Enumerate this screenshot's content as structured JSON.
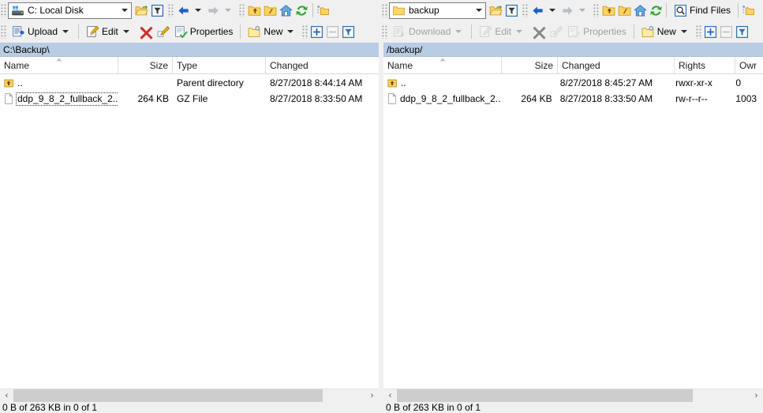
{
  "left": {
    "address": {
      "value": "C: Local Disk",
      "icon": "local-disk-icon"
    },
    "toolbar_nav": {
      "open_dir_icon": "open-folder-icon",
      "filter_icon": "filter-icon",
      "back_icon": "back-arrow-icon",
      "forward_icon": "forward-arrow-icon",
      "parent_icon": "parent-directory-icon",
      "root_icon": "root-directory-icon",
      "home_icon": "home-icon",
      "refresh_icon": "refresh-icon",
      "bookmark_icon": "add-bookmark-icon"
    },
    "toolbar_actions": [
      {
        "label": "Upload",
        "icon": "upload-icon",
        "dropdown": true,
        "disabled": false
      },
      {
        "label": "Edit",
        "icon": "edit-icon",
        "dropdown": true,
        "disabled": false
      },
      {
        "label": "",
        "icon": "delete-icon",
        "dropdown": false,
        "disabled": false
      },
      {
        "label": "",
        "icon": "rename-icon",
        "dropdown": false,
        "disabled": false
      },
      {
        "label": "Properties",
        "icon": "properties-icon",
        "dropdown": false,
        "disabled": false
      },
      {
        "label": "New",
        "icon": "new-folder-icon",
        "dropdown": true,
        "disabled": false
      },
      {
        "label": "",
        "icon": "select-plus-icon",
        "dropdown": false,
        "disabled": false
      },
      {
        "label": "",
        "icon": "select-minus-icon",
        "dropdown": false,
        "disabled": true
      },
      {
        "label": "",
        "icon": "selection-filter-icon",
        "dropdown": false,
        "disabled": false
      }
    ],
    "path": "C:\\Backup\\",
    "columns": [
      "Name",
      "Size",
      "Type",
      "Changed"
    ],
    "sorted_column": "Name",
    "sort_direction": "ascending",
    "rows": [
      {
        "name": "..",
        "icon": "parent-folder-icon",
        "size": "",
        "type": "Parent directory",
        "changed": "8/27/2018  8:44:14 AM",
        "focused": false
      },
      {
        "name": "ddp_9_8_2_fullback_2...",
        "icon": "file-icon",
        "size": "264 KB",
        "type": "GZ File",
        "changed": "8/27/2018  8:33:50 AM",
        "focused": true
      }
    ],
    "status": "0 B of 263 KB in 0 of 1"
  },
  "right": {
    "address": {
      "value": "backup",
      "icon": "remote-folder-icon"
    },
    "toolbar_nav": {
      "open_dir_icon": "open-folder-icon",
      "filter_icon": "filter-icon",
      "back_icon": "back-arrow-icon",
      "forward_icon": "forward-arrow-icon",
      "parent_icon": "parent-directory-icon",
      "root_icon": "root-directory-icon",
      "home_icon": "home-icon",
      "refresh_icon": "refresh-icon",
      "find_files_label": "Find Files",
      "find_files_icon": "find-files-icon",
      "bookmark_icon": "add-bookmark-icon"
    },
    "toolbar_actions": [
      {
        "label": "Download",
        "icon": "download-icon",
        "dropdown": true,
        "disabled": true
      },
      {
        "label": "Edit",
        "icon": "edit-icon",
        "dropdown": true,
        "disabled": true
      },
      {
        "label": "",
        "icon": "delete-icon",
        "dropdown": false,
        "disabled": true
      },
      {
        "label": "",
        "icon": "rename-icon",
        "dropdown": false,
        "disabled": true
      },
      {
        "label": "Properties",
        "icon": "properties-icon",
        "dropdown": false,
        "disabled": true
      },
      {
        "label": "New",
        "icon": "new-folder-icon",
        "dropdown": true,
        "disabled": false
      },
      {
        "label": "",
        "icon": "select-plus-icon",
        "dropdown": false,
        "disabled": false
      },
      {
        "label": "",
        "icon": "select-minus-icon",
        "dropdown": false,
        "disabled": true
      },
      {
        "label": "",
        "icon": "selection-filter-icon",
        "dropdown": false,
        "disabled": false
      }
    ],
    "path": "/backup/",
    "columns": [
      "Name",
      "Size",
      "Changed",
      "Rights",
      "Owr"
    ],
    "sorted_column": "Name",
    "sort_direction": "ascending",
    "rows": [
      {
        "name": "..",
        "icon": "parent-folder-icon",
        "size": "",
        "changed": "8/27/2018 8:45:27 AM",
        "rights": "rwxr-xr-x",
        "owner": "0",
        "focused": false
      },
      {
        "name": "ddp_9_8_2_fullback_2...",
        "icon": "file-icon",
        "size": "264 KB",
        "changed": "8/27/2018 8:33:50 AM",
        "rights": "rw-r--r--",
        "owner": "1003",
        "focused": false
      }
    ],
    "status": "0 B of 263 KB in 0 of 1"
  },
  "scrollbar": {
    "left_arrow": "‹",
    "right_arrow": "›"
  },
  "colors": {
    "path_bar": "#b8cce4",
    "toolbar_bg": "#f0f0f0",
    "list_bg": "#ffffff",
    "folder_yellow": "#ffd25e",
    "accent_blue": "#2a64c8"
  }
}
